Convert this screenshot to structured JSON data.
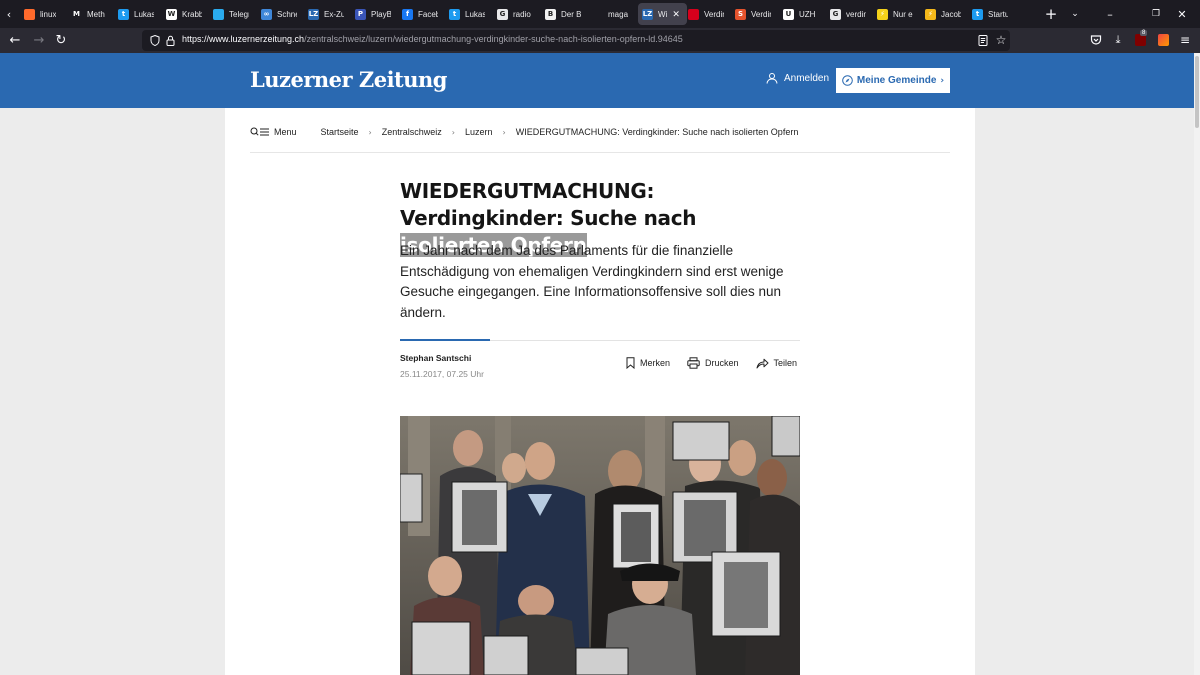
{
  "browser": {
    "tabs": [
      {
        "label": "linux",
        "icon": "brave-icon",
        "color": "#ff6a2c",
        "glyph": ""
      },
      {
        "label": "Meth",
        "icon": "medium-icon",
        "color": "#1c1b22",
        "glyph": "M"
      },
      {
        "label": "Lukas",
        "icon": "twitter-icon",
        "color": "#1d9bf0",
        "glyph": "t"
      },
      {
        "label": "Krabb",
        "icon": "wikipedia-icon",
        "color": "#ffffff",
        "glyph": "W"
      },
      {
        "label": "Telegr",
        "icon": "telegram-icon",
        "color": "#2aabee",
        "glyph": ""
      },
      {
        "label": "Schne",
        "icon": "link-icon",
        "color": "#3f87d9",
        "glyph": "∞"
      },
      {
        "label": "Ex-Zu",
        "icon": "lz-icon",
        "color": "#2a69b1",
        "glyph": "LZ"
      },
      {
        "label": "PlayB",
        "icon": "playbook-icon",
        "color": "#3a55b8",
        "glyph": "P"
      },
      {
        "label": "Facebo",
        "icon": "facebook-icon",
        "color": "#1877f2",
        "glyph": "f"
      },
      {
        "label": "Lukas",
        "icon": "twitter-icon",
        "color": "#1d9bf0",
        "glyph": "t"
      },
      {
        "label": "radio",
        "icon": "google-icon",
        "color": "#e8e8ea",
        "glyph": "G"
      },
      {
        "label": "Der Bu",
        "icon": "beobachter-icon",
        "color": "#f2f2f2",
        "glyph": "B"
      },
      {
        "label": "magazin",
        "icon": "blank-icon",
        "color": "#1c1b22",
        "glyph": ""
      },
      {
        "label": "Wi",
        "icon": "lz-icon",
        "color": "#2a69b1",
        "glyph": "LZ",
        "active": true
      },
      {
        "label": "Verdin",
        "icon": "srf-icon",
        "color": "#d6001c",
        "glyph": ""
      },
      {
        "label": "Verdin",
        "icon": "swissinfo-icon",
        "color": "#e5532d",
        "glyph": "S"
      },
      {
        "label": "UZH",
        "icon": "uzh-icon",
        "color": "#ffffff",
        "glyph": "U"
      },
      {
        "label": "verdin",
        "icon": "google-icon",
        "color": "#e8e8ea",
        "glyph": "G"
      },
      {
        "label": "Nur e",
        "icon": "bolt-icon",
        "color": "#f4d21a",
        "glyph": "⚡"
      },
      {
        "label": "Jacob",
        "icon": "bolt-icon",
        "color": "#f4b81a",
        "glyph": "⚡"
      },
      {
        "label": "Startu",
        "icon": "twitter-icon",
        "color": "#1d9bf0",
        "glyph": "t"
      }
    ],
    "url_host": "https://www.luzernerzeitung.ch",
    "url_path": "/zentralschweiz/luzern/wiedergutmachung-verdingkinder-suche-nach-isolierten-opfern-ld.94645",
    "extension_badge": "8"
  },
  "header": {
    "logo": "Luzerner Zeitung",
    "login_label": "Anmelden",
    "gemeinde_label": "Meine Gemeinde"
  },
  "breadcrumb": {
    "menu_label": "Menu",
    "items": [
      "Startseite",
      "Zentralschweiz",
      "Luzern",
      "WIEDERGUTMACHUNG: Verdingkinder: Suche nach isolierten Opfern"
    ]
  },
  "article": {
    "headline_part1": "WIEDERGUTMACHUNG: Verdingkinder: Suche nach ",
    "headline_highlight": "isolierten Opfern",
    "lead": "Ein Jahr nach dem Ja des Parlaments für die finanzielle Entschädigung von ehemaligen Verdingkindern sind erst wenige Gesuche eingegangen. Eine Informationsoffensive soll dies nun ändern.",
    "author": "Stephan Santschi",
    "date": "25.11.2017, 07.25 Uhr",
    "actions": {
      "bookmark": "Merken",
      "print": "Drucken",
      "share": "Teilen"
    }
  },
  "colors": {
    "brand_blue": "#2a69b1",
    "chrome_dark": "#1c1b22"
  }
}
